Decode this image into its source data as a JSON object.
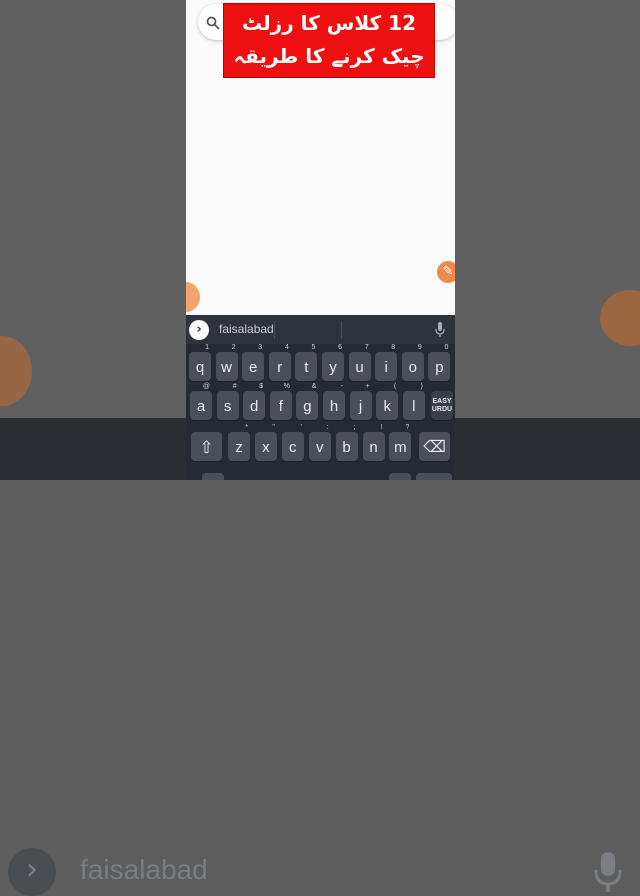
{
  "banner": {
    "line1": "12 کلاس کا رزلٹ",
    "line2": "چیک کرنے کا طریقہ"
  },
  "keyboard": {
    "suggestion": "faisalabad",
    "row1": [
      {
        "k": "q",
        "h": "1"
      },
      {
        "k": "w",
        "h": "2"
      },
      {
        "k": "e",
        "h": "3"
      },
      {
        "k": "r",
        "h": "4"
      },
      {
        "k": "t",
        "h": "5"
      },
      {
        "k": "y",
        "h": "6"
      },
      {
        "k": "u",
        "h": "7"
      },
      {
        "k": "i",
        "h": "8"
      },
      {
        "k": "o",
        "h": "9"
      },
      {
        "k": "p",
        "h": "0"
      }
    ],
    "row2": [
      {
        "k": "a",
        "h": "@"
      },
      {
        "k": "s",
        "h": "#"
      },
      {
        "k": "d",
        "h": "$"
      },
      {
        "k": "f",
        "h": "%"
      },
      {
        "k": "g",
        "h": "&"
      },
      {
        "k": "h",
        "h": "-"
      },
      {
        "k": "j",
        "h": "+"
      },
      {
        "k": "k",
        "h": "("
      },
      {
        "k": "l",
        "h": ")"
      }
    ],
    "easy_label_1": "EASY",
    "easy_label_2": "URDU",
    "row3": [
      {
        "k": "z",
        "h": "*"
      },
      {
        "k": "x",
        "h": "\""
      },
      {
        "k": "c",
        "h": "'"
      },
      {
        "k": "v",
        "h": ":"
      },
      {
        "k": "b",
        "h": ";"
      },
      {
        "k": "n",
        "h": "!"
      },
      {
        "k": "m",
        "h": "?"
      }
    ],
    "shift_glyph": "⇧",
    "backspace_glyph": "⌫"
  },
  "background": {
    "suggestion": "faisalabad"
  },
  "colors": {
    "banner_red": "#ee0f10",
    "accent_orange": "#f08a4b",
    "keyboard_bg": "#262b33",
    "key_bg": "#4a4f58"
  }
}
